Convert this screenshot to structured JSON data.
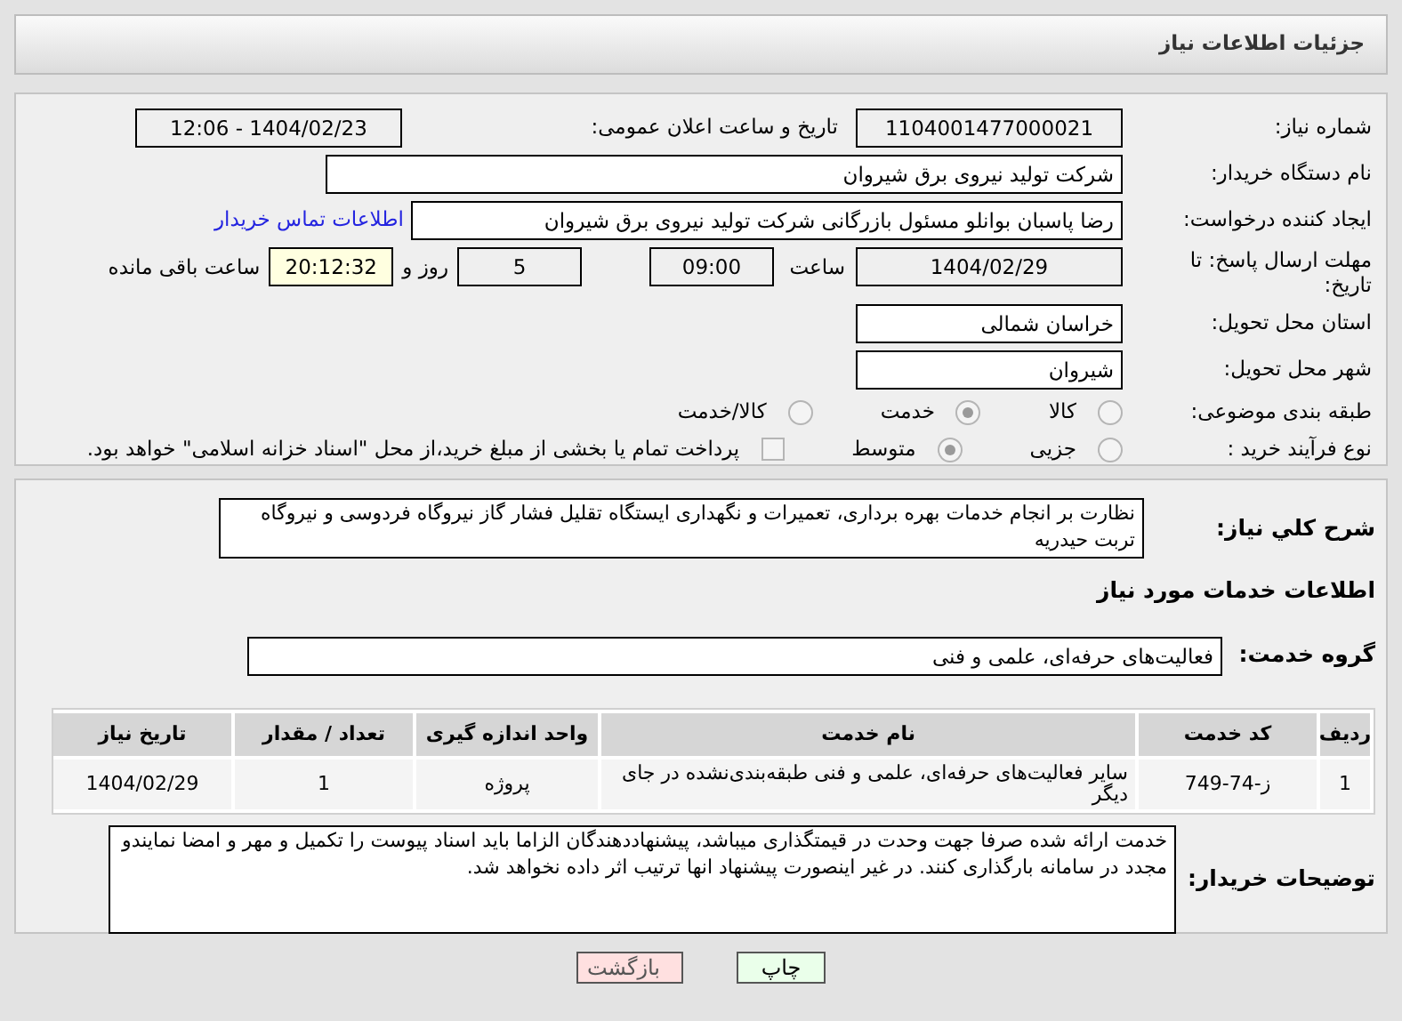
{
  "header": {
    "title": "جزئیات اطلاعات نیاز"
  },
  "fields": {
    "need_number": {
      "label": "شماره نیاز:",
      "value": "1104001477000021"
    },
    "announce": {
      "label": "تاریخ و ساعت اعلان عمومی:",
      "value": "1404/02/23 - 12:06"
    },
    "buyer": {
      "label": "نام دستگاه خریدار:",
      "value": "شرکت تولید نیروی برق شیروان"
    },
    "creator": {
      "label": "ایجاد کننده درخواست:",
      "value": "رضا پاسبان بوانلو مسئول بازرگانی شرکت تولید نیروی برق شیروان",
      "link": "اطلاعات تماس خریدار"
    },
    "deadline": {
      "label": "مهلت ارسال پاسخ: تا تاریخ:",
      "date": "1404/02/29",
      "time_label": "ساعت",
      "time": "09:00",
      "days": "5",
      "days_label": "روز و",
      "remaining": "20:12:32",
      "remaining_label": "ساعت باقی مانده"
    },
    "province": {
      "label": "استان محل تحویل:",
      "value": "خراسان شمالی"
    },
    "city": {
      "label": "شهر محل تحویل:",
      "value": "شیروان"
    },
    "category": {
      "label": "طبقه بندی موضوعی:",
      "options": [
        {
          "label": "کالا",
          "selected": false
        },
        {
          "label": "خدمت",
          "selected": true
        },
        {
          "label": "کالا/خدمت",
          "selected": false
        }
      ]
    },
    "process": {
      "label": "نوع فرآیند خرید :",
      "options": [
        {
          "label": "جزیی",
          "selected": false
        },
        {
          "label": "متوسط",
          "selected": true
        }
      ],
      "payment": {
        "checked": false,
        "text": "پرداخت تمام یا بخشی از مبلغ خرید،از محل \"اسناد خزانه اسلامی\" خواهد بود."
      }
    }
  },
  "description": {
    "label": "شرح کلي نياز:",
    "value": "نظارت بر انجام خدمات بهره برداری، تعمیرات و نگهداری ایستگاه تقلیل فشار گاز نیروگاه فردوسی و نیروگاه تربت حیدریه"
  },
  "services_title": "اطلاعات خدمات مورد نياز",
  "service_group": {
    "label": "گروه خدمت:",
    "value": "فعالیت‌های حرفه‌ای، علمی و فنی"
  },
  "table": {
    "columns": [
      "ردیف",
      "کد خدمت",
      "نام خدمت",
      "واحد اندازه گیری",
      "تعداد / مقدار",
      "تاریخ نیاز"
    ],
    "rows": [
      [
        "1",
        "ز-74-749",
        "سایر فعالیت‌های حرفه‌ای، علمی و فنی طبقه‌بندی‌نشده در جای دیگر",
        "پروژه",
        "1",
        "1404/02/29"
      ]
    ]
  },
  "notes": {
    "label": "توضیحات خریدار:",
    "value": "خدمت ارائه شده صرفا جهت وحدت در قیمتگذاری میباشد، پیشنهاددهندگان الزاما باید اسناد پیوست را تکمیل و مهر و امضا نمایندو مجدد در سامانه بارگذاری کنند. در غیر اینصورت پیشنهاد انها ترتیب اثر داده نخواهد شد."
  },
  "buttons": [
    {
      "kind": "print",
      "label": "چاپ"
    },
    {
      "kind": "back",
      "label": "بازگشت"
    }
  ]
}
